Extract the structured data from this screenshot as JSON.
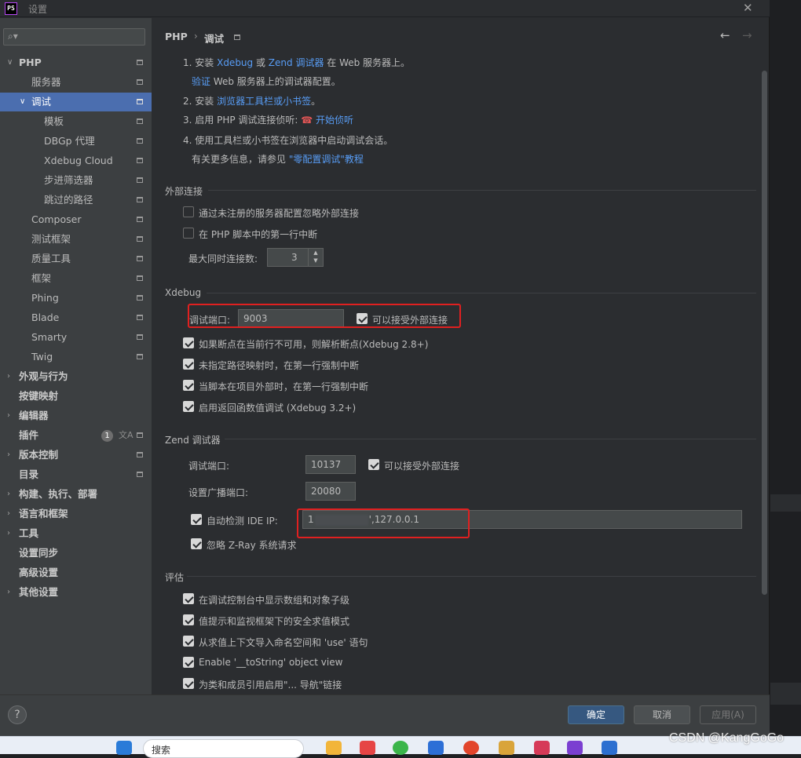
{
  "window": {
    "title": "设置"
  },
  "search": {
    "placeholder": ""
  },
  "sidebar": {
    "php": "PHP",
    "servers": "服务器",
    "debug": "调试",
    "templates": "模板",
    "dbgp": "DBGp 代理",
    "xdebug_cloud": "Xdebug Cloud",
    "step_filters": "步进筛选器",
    "skipped_paths": "跳过的路径",
    "composer": "Composer",
    "test_frameworks": "测试框架",
    "quality_tools": "质量工具",
    "frameworks": "框架",
    "phing": "Phing",
    "blade": "Blade",
    "smarty": "Smarty",
    "twig": "Twig",
    "appearance": "外观与行为",
    "keymap": "按键映射",
    "editor": "编辑器",
    "plugins": "插件",
    "plugins_badge": "1",
    "vcs": "版本控制",
    "directories": "目录",
    "build": "构建、执行、部署",
    "languages": "语言和框架",
    "tools": "工具",
    "sync": "设置同步",
    "advanced": "高级设置",
    "other": "其他设置"
  },
  "breadcrumb": {
    "root": "PHP",
    "sep": "›",
    "current": "调试"
  },
  "steps": {
    "s1_pre": "1. 安装 ",
    "s1_xdebug": "Xdebug",
    "s1_or": " 或 ",
    "s1_zend": "Zend 调试器",
    "s1_post": " 在 Web 服务器上。",
    "s1b_link": "验证",
    "s1b_post": " Web 服务器上的调试器配置。",
    "s2_pre": "2. 安装 ",
    "s2_link": "浏览器工具栏或小书签",
    "s2_post": "。",
    "s3_pre": "3. 启用 PHP 调试连接侦听: ",
    "s3_link": "开始侦听",
    "s4": "4. 使用工具栏或小书签在浏览器中启动调试会话。",
    "s4b_pre": "有关更多信息，请参见 ",
    "s4b_link": "\"零配置调试\"教程"
  },
  "external": {
    "title": "外部连接",
    "ignore_unregistered": "通过未注册的服务器配置忽略外部连接",
    "break_first_line": "在 PHP 脚本中的第一行中断",
    "max_connections_label": "最大同时连接数:",
    "max_connections": "3"
  },
  "xdebug": {
    "title": "Xdebug",
    "port_label": "调试端口:",
    "port": "9003",
    "accept_external": "可以接受外部连接",
    "resolve_breakpoint": "如果断点在当前行不可用，则解析断点(Xdebug 2.8+)",
    "force_break_no_mapping": "未指定路径映射时，在第一行强制中断",
    "force_break_outside": "当脚本在项目外部时，在第一行强制中断",
    "return_values": "启用返回函数值调试 (Xdebug 3.2+)"
  },
  "zend": {
    "title": "Zend 调试器",
    "port_label": "调试端口:",
    "port": "10137",
    "accept_external": "可以接受外部连接",
    "broadcast_label": "设置广播端口:",
    "broadcast_port": "20080",
    "auto_ip_label": "自动检测 IDE IP:",
    "ip_prefix": "1",
    "ip_suffix": "',127.0.0.1",
    "ignore_zray": "忽略 Z-Ray 系统请求"
  },
  "eval": {
    "title": "评估",
    "show_arrays": "在调试控制台中显示数组和对象子级",
    "safe_mode": "值提示和监视框架下的安全求值模式",
    "import_ns": "从求值上下文导入命名空间和 'use' 语句",
    "tostring": "Enable '__toString' object view",
    "navigation": "为类和成员引用启用\"... 导航\"链接"
  },
  "footer": {
    "help": "?",
    "ok": "确定",
    "cancel": "取消",
    "apply": "应用(A)"
  },
  "taskbar": {
    "search": "搜索"
  },
  "watermark": "CSDN @KangGoGo"
}
